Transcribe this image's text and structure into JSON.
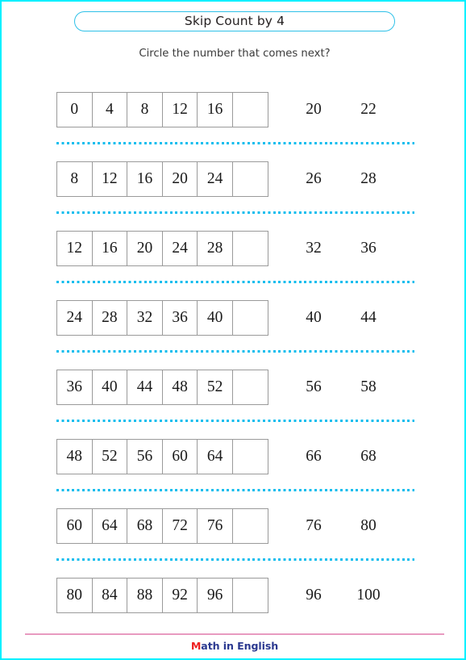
{
  "page": {
    "title": "Skip Count by 4",
    "instruction": "Circle the number that comes next?",
    "border_color": "#00f0ff",
    "title_border_color": "#2ec1e8",
    "separator_color": "#10bdee",
    "cell_border_color": "#9a9a9a"
  },
  "footer": {
    "rule_color": "#e89ac0",
    "logo_initial": "M",
    "logo_rest": "ath in English",
    "logo_initial_color": "#ee2222",
    "logo_rest_color": "#2b3990"
  },
  "problems": [
    {
      "sequence": [
        "0",
        "4",
        "8",
        "12",
        "16",
        ""
      ],
      "choices": [
        "20",
        "22"
      ]
    },
    {
      "sequence": [
        "8",
        "12",
        "16",
        "20",
        "24",
        ""
      ],
      "choices": [
        "26",
        "28"
      ]
    },
    {
      "sequence": [
        "12",
        "16",
        "20",
        "24",
        "28",
        ""
      ],
      "choices": [
        "32",
        "36"
      ]
    },
    {
      "sequence": [
        "24",
        "28",
        "32",
        "36",
        "40",
        ""
      ],
      "choices": [
        "40",
        "44"
      ]
    },
    {
      "sequence": [
        "36",
        "40",
        "44",
        "48",
        "52",
        ""
      ],
      "choices": [
        "56",
        "58"
      ]
    },
    {
      "sequence": [
        "48",
        "52",
        "56",
        "60",
        "64",
        ""
      ],
      "choices": [
        "66",
        "68"
      ]
    },
    {
      "sequence": [
        "60",
        "64",
        "68",
        "72",
        "76",
        ""
      ],
      "choices": [
        "76",
        "80"
      ]
    },
    {
      "sequence": [
        "80",
        "84",
        "88",
        "92",
        "96",
        ""
      ],
      "choices": [
        "96",
        "100"
      ]
    }
  ]
}
